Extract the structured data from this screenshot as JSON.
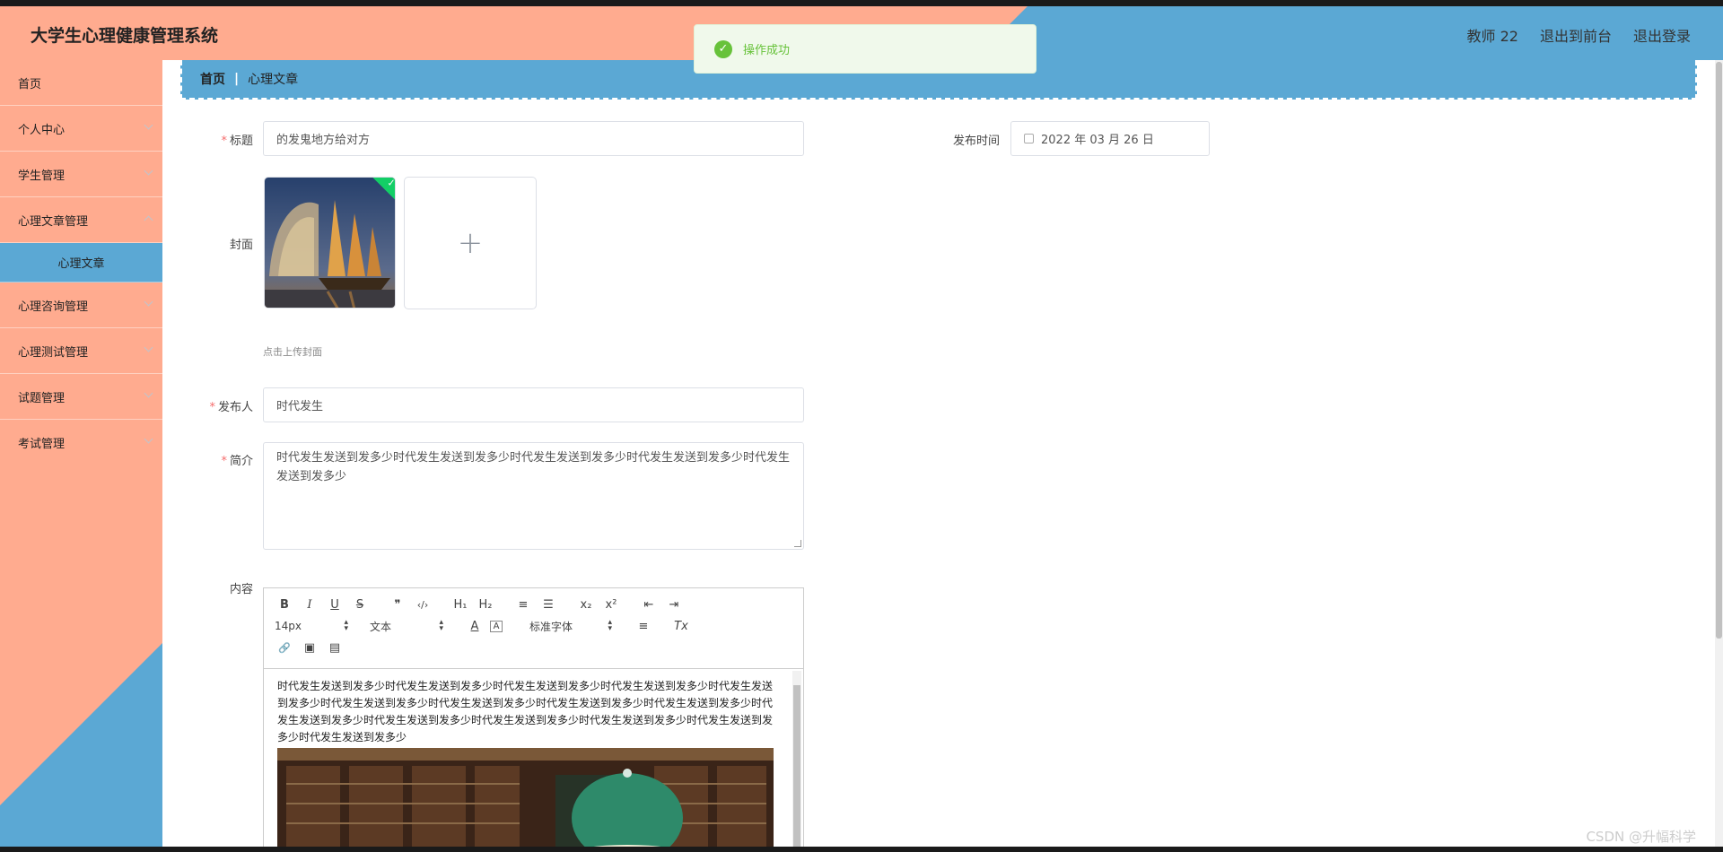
{
  "app": {
    "title": "大学生心理健康管理系统",
    "user": "教师 22",
    "to_front": "退出到前台",
    "logout": "退出登录"
  },
  "toast": {
    "message": "操作成功",
    "type": "success"
  },
  "sidebar": {
    "items": [
      {
        "label": "首页"
      },
      {
        "label": "个人中心"
      },
      {
        "label": "学生管理"
      },
      {
        "label": "心理文章管理"
      },
      {
        "label": "心理文章",
        "sub": true,
        "active": true
      },
      {
        "label": "心理咨询管理"
      },
      {
        "label": "心理测试管理"
      },
      {
        "label": "试题管理"
      },
      {
        "label": "考试管理"
      }
    ]
  },
  "breadcrumb": {
    "home": "首页",
    "separator": "|",
    "current": "心理文章"
  },
  "form": {
    "title_label": "标题",
    "title_value": "的发鬼地方给对方",
    "publish_time_label": "发布时间",
    "publish_time_value": "2022 年 03 月 26 日",
    "cover_label": "封面",
    "cover_hint": "点击上传封面",
    "publisher_label": "发布人",
    "publisher_value": "时代发生",
    "intro_label": "简介",
    "intro_value": "时代发生发送到发多少时代发生发送到发多少时代发生发送到发多少时代发生发送到发多少时代发生发送到发多少",
    "content_label": "内容"
  },
  "editor": {
    "font_size": "14px",
    "paragraph": "文本",
    "font_family": "标准字体",
    "content_text": "时代发生发送到发多少时代发生发送到发多少时代发生发送到发多少时代发生发送到发多少时代发生发送到发多少时代发生发送到发多少时代发生发送到发多少时代发生发送到发多少时代发生发送到发多少时代发生发送到发多少时代发生发送到发多少时代发生发送到发多少时代发生发送到发多少时代发生发送到发多少时代发生发送到发多少",
    "tools": {
      "bold": "B",
      "italic": "I",
      "underline": "U",
      "strike": "S",
      "quote": "❞",
      "code": "‹/›",
      "h1": "H₁",
      "h2": "H₂",
      "ordered": "≡",
      "bullet": "☰",
      "sub": "x₂",
      "sup": "x²",
      "outdent": "⇤",
      "indent": "⇥",
      "color": "A",
      "background": "A",
      "align": "≡",
      "clean": "Tx",
      "link": "🔗",
      "image": "▣",
      "video": "▤"
    }
  },
  "watermark": "CSDN @升幅科学",
  "colors": {
    "salmon": "#ffab8f",
    "blue": "#5ba8d4",
    "success": "#67c23a",
    "required": "#f56c6c"
  }
}
